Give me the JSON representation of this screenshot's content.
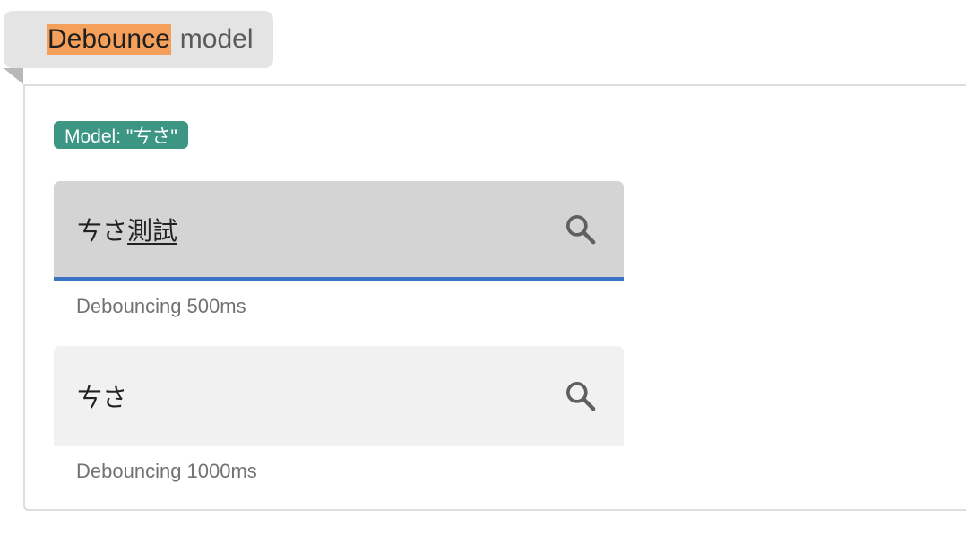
{
  "title": {
    "highlight": "Debounce",
    "rest": "model"
  },
  "badge": {
    "text": "Model: \"ㄘさ\""
  },
  "fields": [
    {
      "value_plain": "ㄘさ",
      "value_composing": "測試",
      "helper": "Debouncing 500ms",
      "icon": "search-icon",
      "state": "focused"
    },
    {
      "value_plain": "ㄘさ",
      "value_composing": "",
      "helper": "Debouncing 1000ms",
      "icon": "search-icon",
      "state": "idle"
    }
  ],
  "colors": {
    "highlight": "#f4a05a",
    "badge": "#3d9584",
    "focus_underline": "#3b73c6"
  }
}
